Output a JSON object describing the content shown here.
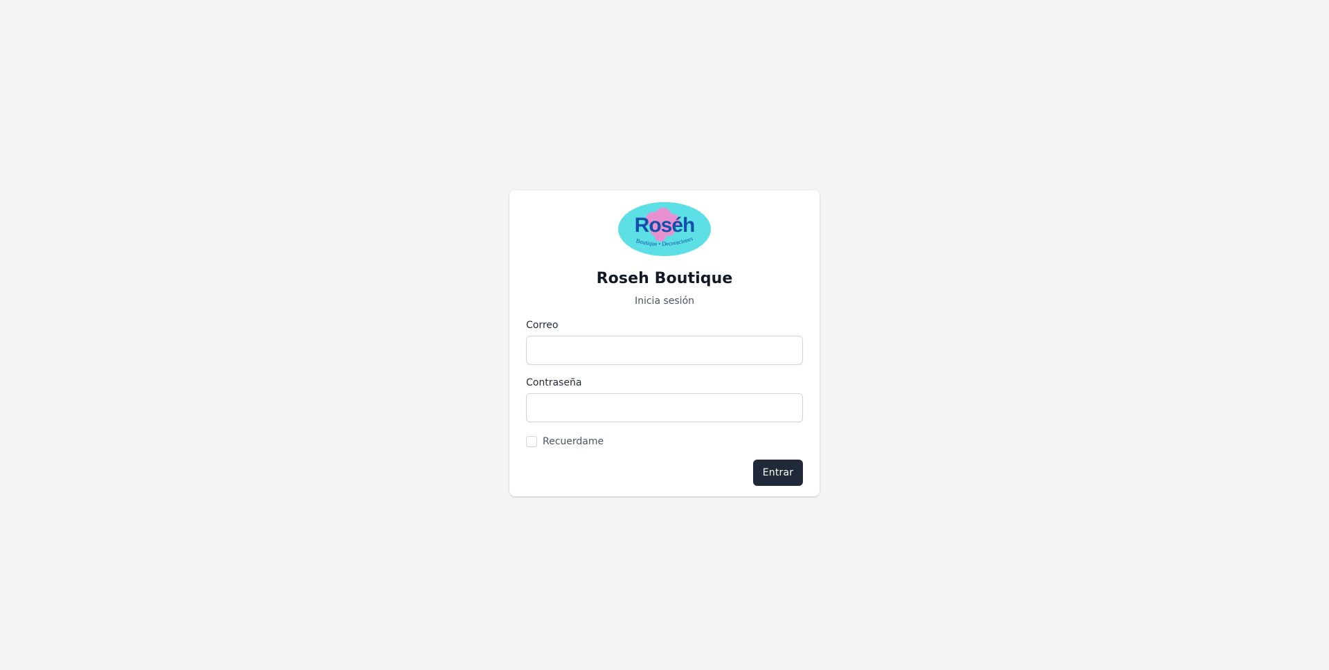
{
  "brand": {
    "logo_word": "Roséh",
    "logo_tagline": "Boutique • Decoraciones",
    "colors": {
      "logo_background": "#5ddfe6",
      "logo_blob": "#f08ccf",
      "logo_text": "#1450a8",
      "button": "#1f2937",
      "page_background": "#f3f4f6"
    }
  },
  "login": {
    "title": "Roseh Boutique",
    "subtitle": "Inicia sesión",
    "email_label": "Correo",
    "email_value": "",
    "password_label": "Contraseña",
    "password_value": "",
    "remember_label": "Recuerdame",
    "remember_checked": false,
    "submit_label": "Entrar"
  }
}
